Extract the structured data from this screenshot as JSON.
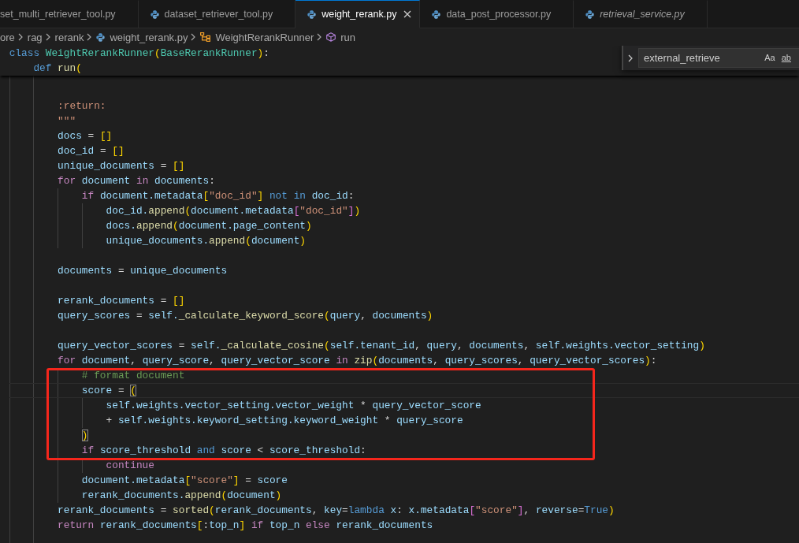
{
  "tabs": [
    {
      "label": "set_multi_retriever_tool.py",
      "selected": false,
      "preview": false,
      "clipped": true
    },
    {
      "label": "dataset_retriever_tool.py",
      "selected": false,
      "preview": false,
      "clipped": false
    },
    {
      "label": "weight_rerank.py",
      "selected": true,
      "preview": false,
      "clipped": false
    },
    {
      "label": "data_post_processor.py",
      "selected": false,
      "preview": false,
      "clipped": false
    },
    {
      "label": "retrieval_service.py",
      "selected": false,
      "preview": true,
      "clipped": false
    }
  ],
  "breadcrumbs": [
    {
      "label": "ore",
      "kind": "folder"
    },
    {
      "label": "rag",
      "kind": "folder"
    },
    {
      "label": "rerank",
      "kind": "folder"
    },
    {
      "label": "weight_rerank.py",
      "kind": "file"
    },
    {
      "label": "WeightRerankRunner",
      "kind": "class"
    },
    {
      "label": "run",
      "kind": "method"
    }
  ],
  "find_widget": {
    "value": "external_retrieve",
    "expanded": false,
    "options": [
      {
        "label": "Aa",
        "kind": "case"
      },
      {
        "label": "ab",
        "kind": "word"
      }
    ]
  },
  "sticky_scroll": [
    {
      "kind": "code",
      "tokens": [
        {
          "kind": "keyword",
          "text": "class "
        },
        {
          "kind": "type",
          "text": "WeightRerankRunner"
        },
        {
          "kind": "bracket1",
          "text": "("
        },
        {
          "kind": "type",
          "text": "BaseRerankRunner"
        },
        {
          "kind": "bracket1",
          "text": ")"
        },
        {
          "kind": "plain",
          "text": ":"
        }
      ],
      "children": [
        {
          "kind": "code",
          "tokens": [
            {
              "kind": "keyword",
              "text": "def "
            },
            {
              "kind": "function",
              "text": "run"
            },
            {
              "kind": "bracket1",
              "text": "("
            }
          ]
        }
      ]
    }
  ],
  "code": [
    {
      "kind": "blank",
      "current": false,
      "annotated": false
    },
    {
      "kind": "blank",
      "current": false,
      "annotated": false
    },
    {
      "kind": "code",
      "current": false,
      "annotated": false,
      "tokens": [
        {
          "kind": "string",
          "text": ":return:"
        }
      ]
    },
    {
      "kind": "code",
      "current": false,
      "annotated": false,
      "tokens": [
        {
          "kind": "string",
          "text": "\"\"\""
        }
      ]
    },
    {
      "kind": "code",
      "current": false,
      "annotated": false,
      "tokens": [
        {
          "kind": "variable",
          "text": "docs "
        },
        {
          "kind": "plain",
          "text": "= "
        },
        {
          "kind": "bracket1",
          "text": "[]"
        }
      ]
    },
    {
      "kind": "code",
      "current": false,
      "annotated": false,
      "tokens": [
        {
          "kind": "variable",
          "text": "doc_id "
        },
        {
          "kind": "plain",
          "text": "= "
        },
        {
          "kind": "bracket1",
          "text": "[]"
        }
      ]
    },
    {
      "kind": "code",
      "current": false,
      "annotated": false,
      "tokens": [
        {
          "kind": "variable",
          "text": "unique_documents "
        },
        {
          "kind": "plain",
          "text": "= "
        },
        {
          "kind": "bracket1",
          "text": "[]"
        }
      ]
    },
    {
      "kind": "code",
      "current": false,
      "annotated": false,
      "tokens": [
        {
          "kind": "control",
          "text": "for "
        },
        {
          "kind": "variable",
          "text": "document "
        },
        {
          "kind": "control",
          "text": "in "
        },
        {
          "kind": "variable",
          "text": "documents"
        },
        {
          "kind": "plain",
          "text": ":"
        }
      ],
      "children": [
        {
          "kind": "code",
          "current": false,
          "annotated": false,
          "tokens": [
            {
              "kind": "control",
              "text": "if "
            },
            {
              "kind": "variable",
              "text": "document.metadata"
            },
            {
              "kind": "bracket1",
              "text": "["
            },
            {
              "kind": "string",
              "text": "\"doc_id\""
            },
            {
              "kind": "bracket1",
              "text": "] "
            },
            {
              "kind": "keyword",
              "text": "not in "
            },
            {
              "kind": "variable",
              "text": "doc_id"
            },
            {
              "kind": "plain",
              "text": ":"
            }
          ],
          "children": [
            {
              "kind": "code",
              "current": false,
              "annotated": false,
              "tokens": [
                {
                  "kind": "variable",
                  "text": "doc_id."
                },
                {
                  "kind": "function",
                  "text": "append"
                },
                {
                  "kind": "bracket1",
                  "text": "("
                },
                {
                  "kind": "variable",
                  "text": "document.metadata"
                },
                {
                  "kind": "bracket2",
                  "text": "["
                },
                {
                  "kind": "string",
                  "text": "\"doc_id\""
                },
                {
                  "kind": "bracket2",
                  "text": "]"
                },
                {
                  "kind": "bracket1",
                  "text": ")"
                }
              ]
            },
            {
              "kind": "code",
              "current": false,
              "annotated": false,
              "tokens": [
                {
                  "kind": "variable",
                  "text": "docs."
                },
                {
                  "kind": "function",
                  "text": "append"
                },
                {
                  "kind": "bracket1",
                  "text": "("
                },
                {
                  "kind": "variable",
                  "text": "document.page_content"
                },
                {
                  "kind": "bracket1",
                  "text": ")"
                }
              ]
            },
            {
              "kind": "code",
              "current": false,
              "annotated": false,
              "tokens": [
                {
                  "kind": "variable",
                  "text": "unique_documents."
                },
                {
                  "kind": "function",
                  "text": "append"
                },
                {
                  "kind": "bracket1",
                  "text": "("
                },
                {
                  "kind": "variable",
                  "text": "document"
                },
                {
                  "kind": "bracket1",
                  "text": ")"
                }
              ]
            }
          ]
        }
      ]
    },
    {
      "kind": "blank",
      "current": false,
      "annotated": false
    },
    {
      "kind": "code",
      "current": false,
      "annotated": false,
      "tokens": [
        {
          "kind": "variable",
          "text": "documents "
        },
        {
          "kind": "plain",
          "text": "= "
        },
        {
          "kind": "variable",
          "text": "unique_documents"
        }
      ]
    },
    {
      "kind": "blank",
      "current": false,
      "annotated": false
    },
    {
      "kind": "code",
      "current": false,
      "annotated": false,
      "tokens": [
        {
          "kind": "variable",
          "text": "rerank_documents "
        },
        {
          "kind": "plain",
          "text": "= "
        },
        {
          "kind": "bracket1",
          "text": "[]"
        }
      ]
    },
    {
      "kind": "code",
      "current": false,
      "annotated": false,
      "tokens": [
        {
          "kind": "variable",
          "text": "query_scores "
        },
        {
          "kind": "plain",
          "text": "= "
        },
        {
          "kind": "variable",
          "text": "self."
        },
        {
          "kind": "function",
          "text": "_calculate_keyword_score"
        },
        {
          "kind": "bracket1",
          "text": "("
        },
        {
          "kind": "variable",
          "text": "query"
        },
        {
          "kind": "plain",
          "text": ", "
        },
        {
          "kind": "variable",
          "text": "documents"
        },
        {
          "kind": "bracket1",
          "text": ")"
        }
      ]
    },
    {
      "kind": "blank",
      "current": false,
      "annotated": false
    },
    {
      "kind": "code",
      "current": false,
      "annotated": false,
      "tokens": [
        {
          "kind": "variable",
          "text": "query_vector_scores "
        },
        {
          "kind": "plain",
          "text": "= "
        },
        {
          "kind": "variable",
          "text": "self."
        },
        {
          "kind": "function",
          "text": "_calculate_cosine"
        },
        {
          "kind": "bracket1",
          "text": "("
        },
        {
          "kind": "variable",
          "text": "self.tenant_id"
        },
        {
          "kind": "plain",
          "text": ", "
        },
        {
          "kind": "variable",
          "text": "query"
        },
        {
          "kind": "plain",
          "text": ", "
        },
        {
          "kind": "variable",
          "text": "documents"
        },
        {
          "kind": "plain",
          "text": ", "
        },
        {
          "kind": "variable",
          "text": "self.weights.vector_setting"
        },
        {
          "kind": "bracket1",
          "text": ")"
        }
      ]
    },
    {
      "kind": "code",
      "current": false,
      "annotated": false,
      "tokens": [
        {
          "kind": "control",
          "text": "for "
        },
        {
          "kind": "variable",
          "text": "document"
        },
        {
          "kind": "plain",
          "text": ", "
        },
        {
          "kind": "variable",
          "text": "query_score"
        },
        {
          "kind": "plain",
          "text": ", "
        },
        {
          "kind": "variable",
          "text": "query_vector_score "
        },
        {
          "kind": "control",
          "text": "in "
        },
        {
          "kind": "function",
          "text": "zip"
        },
        {
          "kind": "bracket1",
          "text": "("
        },
        {
          "kind": "variable",
          "text": "documents"
        },
        {
          "kind": "plain",
          "text": ", "
        },
        {
          "kind": "variable",
          "text": "query_scores"
        },
        {
          "kind": "plain",
          "text": ", "
        },
        {
          "kind": "variable",
          "text": "query_vector_scores"
        },
        {
          "kind": "bracket1",
          "text": ")"
        },
        {
          "kind": "plain",
          "text": ":"
        }
      ],
      "children": [
        {
          "kind": "code",
          "current": false,
          "annotated": true,
          "tokens": [
            {
              "kind": "comment",
              "text": "# format document"
            }
          ]
        },
        {
          "kind": "code",
          "current": true,
          "annotated": true,
          "tokens": [
            {
              "kind": "variable",
              "text": "score "
            },
            {
              "kind": "plain",
              "text": "= "
            },
            {
              "kind": "bracketmatch",
              "text": "("
            }
          ],
          "children": [
            {
              "kind": "code",
              "current": false,
              "annotated": true,
              "tokens": [
                {
                  "kind": "variable",
                  "text": "self.weights.vector_setting.vector_weight "
                },
                {
                  "kind": "plain",
                  "text": "* "
                },
                {
                  "kind": "variable",
                  "text": "query_vector_score"
                }
              ]
            },
            {
              "kind": "code",
              "current": false,
              "annotated": true,
              "tokens": [
                {
                  "kind": "plain",
                  "text": "+ "
                },
                {
                  "kind": "variable",
                  "text": "self.weights.keyword_setting.keyword_weight "
                },
                {
                  "kind": "plain",
                  "text": "* "
                },
                {
                  "kind": "variable",
                  "text": "query_score"
                }
              ]
            }
          ]
        },
        {
          "kind": "code",
          "current": false,
          "annotated": true,
          "tokens": [
            {
              "kind": "bracketmatch",
              "text": ")"
            }
          ]
        },
        {
          "kind": "code",
          "current": false,
          "annotated": true,
          "tokens": [
            {
              "kind": "control",
              "text": "if "
            },
            {
              "kind": "variable",
              "text": "score_threshold "
            },
            {
              "kind": "keyword",
              "text": "and "
            },
            {
              "kind": "variable",
              "text": "score "
            },
            {
              "kind": "plain",
              "text": "< "
            },
            {
              "kind": "variable",
              "text": "score_threshold"
            },
            {
              "kind": "plain",
              "text": ":"
            }
          ],
          "children": [
            {
              "kind": "code",
              "current": false,
              "annotated": false,
              "tokens": [
                {
                  "kind": "control",
                  "text": "continue"
                }
              ]
            }
          ]
        },
        {
          "kind": "code",
          "current": false,
          "annotated": false,
          "tokens": [
            {
              "kind": "variable",
              "text": "document.metadata"
            },
            {
              "kind": "bracket1",
              "text": "["
            },
            {
              "kind": "string",
              "text": "\"score\""
            },
            {
              "kind": "bracket1",
              "text": "] "
            },
            {
              "kind": "plain",
              "text": "= "
            },
            {
              "kind": "variable",
              "text": "score"
            }
          ]
        },
        {
          "kind": "code",
          "current": false,
          "annotated": false,
          "tokens": [
            {
              "kind": "variable",
              "text": "rerank_documents."
            },
            {
              "kind": "function",
              "text": "append"
            },
            {
              "kind": "bracket1",
              "text": "("
            },
            {
              "kind": "variable",
              "text": "document"
            },
            {
              "kind": "bracket1",
              "text": ")"
            }
          ]
        }
      ]
    },
    {
      "kind": "code",
      "current": false,
      "annotated": false,
      "tokens": [
        {
          "kind": "variable",
          "text": "rerank_documents "
        },
        {
          "kind": "plain",
          "text": "= "
        },
        {
          "kind": "function",
          "text": "sorted"
        },
        {
          "kind": "bracket1",
          "text": "("
        },
        {
          "kind": "variable",
          "text": "rerank_documents"
        },
        {
          "kind": "plain",
          "text": ", "
        },
        {
          "kind": "variable",
          "text": "key"
        },
        {
          "kind": "plain",
          "text": "="
        },
        {
          "kind": "keyword",
          "text": "lambda "
        },
        {
          "kind": "variable",
          "text": "x"
        },
        {
          "kind": "plain",
          "text": ": "
        },
        {
          "kind": "variable",
          "text": "x.metadata"
        },
        {
          "kind": "bracket2",
          "text": "["
        },
        {
          "kind": "string",
          "text": "\"score\""
        },
        {
          "kind": "bracket2",
          "text": "]"
        },
        {
          "kind": "plain",
          "text": ", "
        },
        {
          "kind": "variable",
          "text": "reverse"
        },
        {
          "kind": "plain",
          "text": "="
        },
        {
          "kind": "keyword",
          "text": "True"
        },
        {
          "kind": "bracket1",
          "text": ")"
        }
      ]
    },
    {
      "kind": "code",
      "current": false,
      "annotated": false,
      "tokens": [
        {
          "kind": "control",
          "text": "return "
        },
        {
          "kind": "variable",
          "text": "rerank_documents"
        },
        {
          "kind": "bracket1",
          "text": "["
        },
        {
          "kind": "plain",
          "text": ":"
        },
        {
          "kind": "variable",
          "text": "top_n"
        },
        {
          "kind": "bracket1",
          "text": "] "
        },
        {
          "kind": "control",
          "text": "if "
        },
        {
          "kind": "variable",
          "text": "top_n "
        },
        {
          "kind": "control",
          "text": "else "
        },
        {
          "kind": "variable",
          "text": "rerank_documents"
        }
      ]
    },
    {
      "kind": "blank",
      "current": false,
      "annotated": false
    }
  ]
}
